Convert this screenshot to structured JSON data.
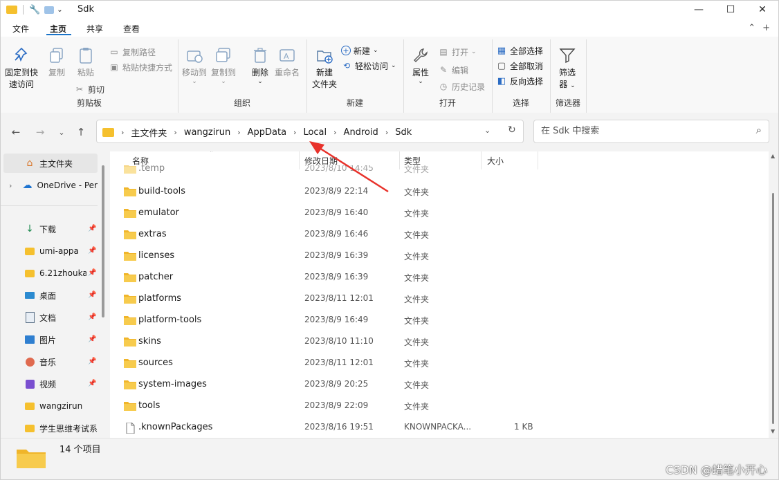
{
  "window": {
    "title": "Sdk",
    "controls": {
      "minimize": "—",
      "maximize": "☐",
      "close": "✕"
    }
  },
  "tabs": [
    {
      "label": "文件"
    },
    {
      "label": "主页"
    },
    {
      "label": "共享"
    },
    {
      "label": "查看"
    }
  ],
  "ribbon": {
    "clipboard": {
      "group_label": "剪贴板",
      "pin_label_1": "固定到快",
      "pin_label_2": "速访问",
      "copy_label": "复制",
      "paste_label": "粘贴",
      "copy_path": "复制路径",
      "paste_shortcut": "粘贴快捷方式",
      "cut": "剪切"
    },
    "organize": {
      "group_label": "组织",
      "move_to": "移动到",
      "copy_to": "复制到",
      "delete": "删除",
      "rename": "重命名"
    },
    "new": {
      "group_label": "新建",
      "new_folder_1": "新建",
      "new_folder_2": "文件夹",
      "new_item": "新建",
      "easy_access": "轻松访问"
    },
    "open": {
      "group_label": "打开",
      "properties": "属性",
      "open": "打开",
      "edit": "编辑",
      "history": "历史记录"
    },
    "select": {
      "group_label": "选择",
      "select_all": "全部选择",
      "select_none": "全部取消",
      "invert": "反向选择"
    },
    "filter": {
      "group_label": "筛选器",
      "label_1": "筛选",
      "label_2": "器"
    }
  },
  "address": {
    "crumbs": [
      "主文件夹",
      "wangzirun",
      "AppData",
      "Local",
      "Android",
      "Sdk"
    ]
  },
  "search": {
    "placeholder": "在 Sdk 中搜索"
  },
  "sidebar": {
    "items": [
      {
        "label": "主文件夹"
      },
      {
        "label": "OneDrive - Per"
      },
      {
        "label": "下载"
      },
      {
        "label": "umi-appa"
      },
      {
        "label": "6.21zhoukao"
      },
      {
        "label": "桌面"
      },
      {
        "label": "文档"
      },
      {
        "label": "图片"
      },
      {
        "label": "音乐"
      },
      {
        "label": "视频"
      },
      {
        "label": "wangzirun"
      },
      {
        "label": "学生思维考试系"
      }
    ]
  },
  "columns": {
    "name": "名称",
    "date": "修改日期",
    "type": "类型",
    "size": "大小"
  },
  "files": [
    {
      "name": ".temp",
      "date": "2023/8/10 14:45",
      "type": "文件夹",
      "size": ""
    },
    {
      "name": "build-tools",
      "date": "2023/8/9 22:14",
      "type": "文件夹",
      "size": ""
    },
    {
      "name": "emulator",
      "date": "2023/8/9 16:40",
      "type": "文件夹",
      "size": ""
    },
    {
      "name": "extras",
      "date": "2023/8/9 16:46",
      "type": "文件夹",
      "size": ""
    },
    {
      "name": "licenses",
      "date": "2023/8/9 16:39",
      "type": "文件夹",
      "size": ""
    },
    {
      "name": "patcher",
      "date": "2023/8/9 16:39",
      "type": "文件夹",
      "size": ""
    },
    {
      "name": "platforms",
      "date": "2023/8/11 12:01",
      "type": "文件夹",
      "size": ""
    },
    {
      "name": "platform-tools",
      "date": "2023/8/9 16:49",
      "type": "文件夹",
      "size": ""
    },
    {
      "name": "skins",
      "date": "2023/8/10 11:10",
      "type": "文件夹",
      "size": ""
    },
    {
      "name": "sources",
      "date": "2023/8/11 12:01",
      "type": "文件夹",
      "size": ""
    },
    {
      "name": "system-images",
      "date": "2023/8/9 20:25",
      "type": "文件夹",
      "size": ""
    },
    {
      "name": "tools",
      "date": "2023/8/9 22:09",
      "type": "文件夹",
      "size": ""
    },
    {
      "name": ".knownPackages",
      "date": "2023/8/16 19:51",
      "type": "KNOWNPACKA...",
      "size": "1 KB"
    }
  ],
  "status": {
    "count": "14 个项目"
  },
  "watermark": "CSDN @蜡笔小开心",
  "colors": {
    "accent": "#1a73c8",
    "folder": "#f5c02e",
    "annotation_arrow": "#e8322b"
  }
}
